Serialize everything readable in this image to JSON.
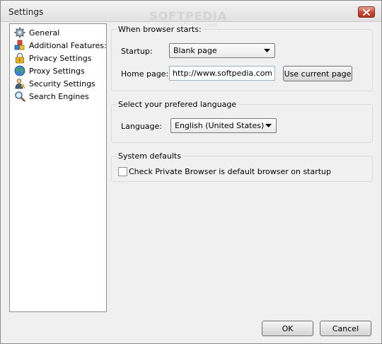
{
  "window": {
    "title": "Settings"
  },
  "watermark": {
    "text": "SOFTPEDIA",
    "sub": "www.softpedia.com"
  },
  "sidebar": {
    "items": [
      {
        "label": "General",
        "icon": "gear-icon"
      },
      {
        "label": "Additional Features:",
        "icon": "blocks-icon"
      },
      {
        "label": "Privacy Settings",
        "icon": "lock-icon"
      },
      {
        "label": "Proxy Settings",
        "icon": "globe-icon"
      },
      {
        "label": "Security Settings",
        "icon": "user-key-icon"
      },
      {
        "label": "Search Engines",
        "icon": "search-icon"
      }
    ]
  },
  "startup_group": {
    "title": "When browser starts:",
    "startup_label": "Startup:",
    "startup_value": "Blank page",
    "homepage_label": "Home page:",
    "homepage_value": "http://www.softpedia.com",
    "use_current_label": "Use current page"
  },
  "language_group": {
    "title": "Select your prefered language",
    "language_label": "Language:",
    "language_value": "English (United States)"
  },
  "defaults_group": {
    "title": "System defaults",
    "checkbox_label": "Check Private Browser is default browser on startup",
    "checked": false
  },
  "footer": {
    "ok_label": "OK",
    "cancel_label": "Cancel"
  },
  "colors": {
    "close_button": "#c4452f",
    "field_border": "#9db1c9"
  }
}
